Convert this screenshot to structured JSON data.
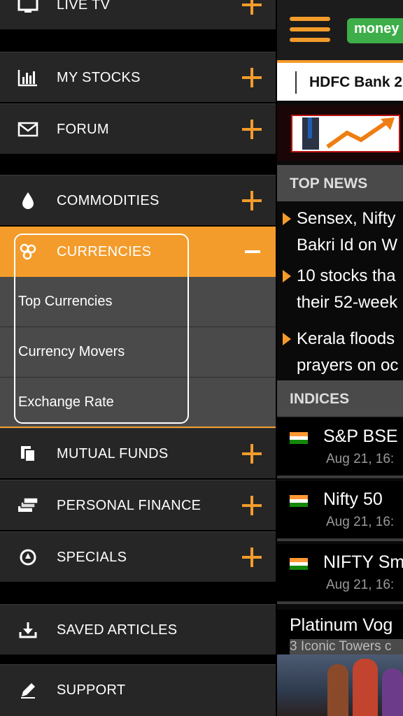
{
  "drawer": {
    "items": [
      {
        "label": "LIVE TV",
        "icon": "tv-icon"
      },
      {
        "label": "MY STOCKS",
        "icon": "bar-chart-icon"
      },
      {
        "label": "FORUM",
        "icon": "envelope-icon"
      },
      {
        "label": "COMMODITIES",
        "icon": "droplet-icon"
      },
      {
        "label": "CURRENCIES",
        "icon": "coins-icon"
      },
      {
        "label": "MUTUAL FUNDS",
        "icon": "documents-icon"
      },
      {
        "label": "PERSONAL FINANCE",
        "icon": "money-stack-icon"
      },
      {
        "label": "SPECIALS",
        "icon": "specials-icon"
      },
      {
        "label": "SAVED ARTICLES",
        "icon": "download-icon"
      },
      {
        "label": "SUPPORT",
        "icon": "pencil-icon"
      }
    ],
    "currencies_submenu": [
      "Top Currencies",
      "Currency Movers",
      "Exchange Rate"
    ]
  },
  "app": {
    "brand": "money",
    "ticker": "HDFC Bank 2",
    "top_news_header": "TOP NEWS",
    "news": [
      {
        "line1": "Sensex, Nifty",
        "line2": "Bakri Id on W"
      },
      {
        "line1": "10 stocks tha",
        "line2": "their 52-week"
      },
      {
        "line1": "Kerala floods",
        "line2": "prayers on oc"
      }
    ],
    "indices_header": "INDICES",
    "indices": [
      {
        "name": "S&P BSE",
        "time": "Aug 21, 16:"
      },
      {
        "name": "Nifty 50",
        "time": "Aug 21, 16:"
      },
      {
        "name": "NIFTY Sm",
        "time": "Aug 21, 16:"
      }
    ],
    "ad": {
      "title": "Platinum Vog",
      "subtitle": "3 Iconic Towers c"
    }
  },
  "colors": {
    "accent": "#f39c2b",
    "drawer_item": "#262626",
    "submenu": "#4a4a4a",
    "brand_green": "#3dae49"
  }
}
